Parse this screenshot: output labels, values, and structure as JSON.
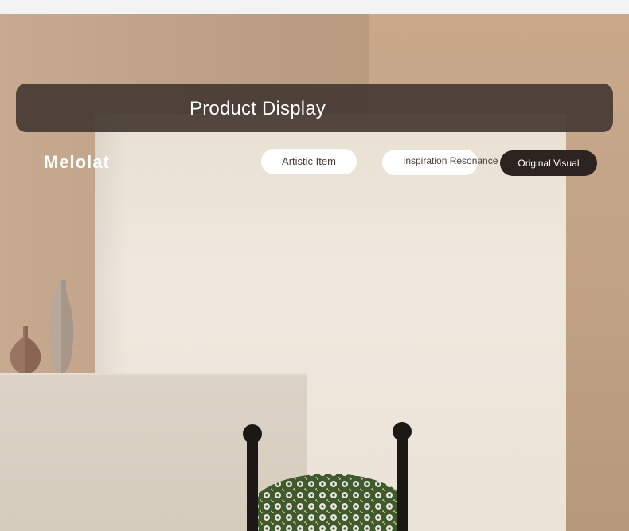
{
  "banner": {
    "title": "Product Display"
  },
  "brand": {
    "name": "Melolat"
  },
  "tabs": [
    {
      "label": "Artistic Item"
    },
    {
      "label": "Inspiration Resonance"
    },
    {
      "label": "Original Visual"
    }
  ],
  "colors": {
    "banner": "#463a34",
    "active_tab": "#2d2421",
    "tab": "#ffffff",
    "wall": "#c3a58a",
    "plinth": "#ece4d8"
  },
  "icons": [
    "vase-illustration",
    "chair-illustration"
  ]
}
